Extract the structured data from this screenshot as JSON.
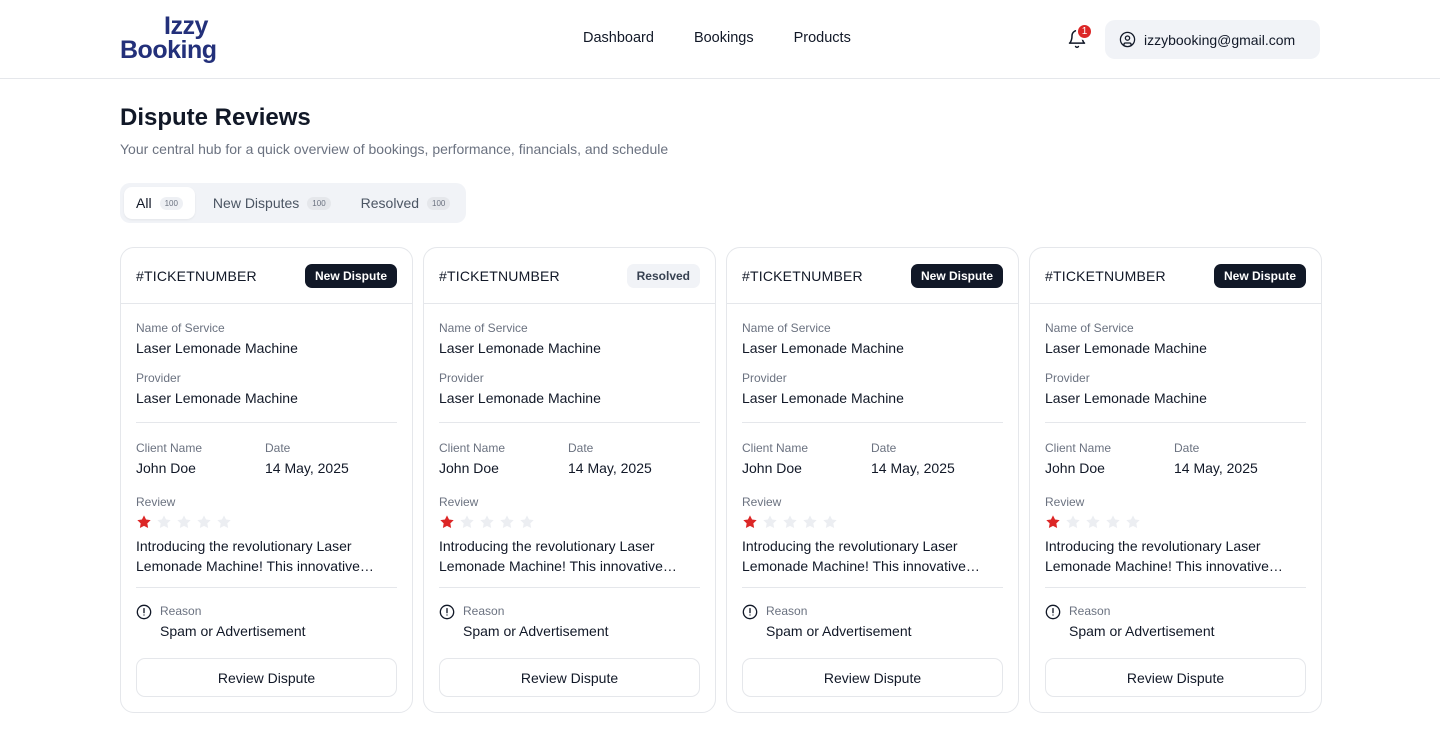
{
  "brand": {
    "line1": "Izzy",
    "line2": "Booking",
    "color": "#23307a"
  },
  "nav": [
    "Dashboard",
    "Bookings",
    "Products"
  ],
  "notifications": {
    "count": "1"
  },
  "account": {
    "email": "izzybooking@gmail.com"
  },
  "page": {
    "title": "Dispute Reviews",
    "subtitle": "Your central hub for a quick overview of bookings, performance, financials, and schedule"
  },
  "tabs": [
    {
      "label": "All",
      "count": "100",
      "active": true
    },
    {
      "label": "New Disputes",
      "count": "100",
      "active": false
    },
    {
      "label": "Resolved",
      "count": "100",
      "active": false
    }
  ],
  "labels": {
    "service": "Name of Service",
    "provider": "Provider",
    "client": "Client Name",
    "date": "Date",
    "review": "Review",
    "reason": "Reason",
    "button": "Review Dispute"
  },
  "cards": [
    {
      "ticket": "#TICKETNUMBER",
      "status": "New Dispute",
      "status_type": "new",
      "service": "Laser Lemonade Machine",
      "provider": "Laser Lemonade Machine",
      "client": "John Doe",
      "date": "14 May, 2025",
      "rating": 1,
      "review": "Introducing the revolutionary Laser Lemonade Machine! This innovative device is designed to transform your lemonade experience.",
      "reason": "Spam or Advertisement"
    },
    {
      "ticket": "#TICKETNUMBER",
      "status": "Resolved",
      "status_type": "resolved",
      "service": "Laser Lemonade Machine",
      "provider": "Laser Lemonade Machine",
      "client": "John Doe",
      "date": "14 May, 2025",
      "rating": 1,
      "review": "Introducing the revolutionary Laser Lemonade Machine! This innovative device is designed to transform your lemonade experience.",
      "reason": "Spam or Advertisement"
    },
    {
      "ticket": "#TICKETNUMBER",
      "status": "New Dispute",
      "status_type": "new",
      "service": "Laser Lemonade Machine",
      "provider": "Laser Lemonade Machine",
      "client": "John Doe",
      "date": "14 May, 2025",
      "rating": 1,
      "review": "Introducing the revolutionary Laser Lemonade Machine! This innovative device is designed to transform your lemonade experience.",
      "reason": "Spam or Advertisement"
    },
    {
      "ticket": "#TICKETNUMBER",
      "status": "New Dispute",
      "status_type": "new",
      "service": "Laser Lemonade Machine",
      "provider": "Laser Lemonade Machine",
      "client": "John Doe",
      "date": "14 May, 2025",
      "rating": 1,
      "review": "Introducing the revolutionary Laser Lemonade Machine! This innovative device is designed to transform your lemonade experience.",
      "reason": "Spam or Advertisement"
    }
  ],
  "colors": {
    "star_filled": "#dc2626",
    "star_empty": "#eceef2",
    "dark": "#111827"
  }
}
